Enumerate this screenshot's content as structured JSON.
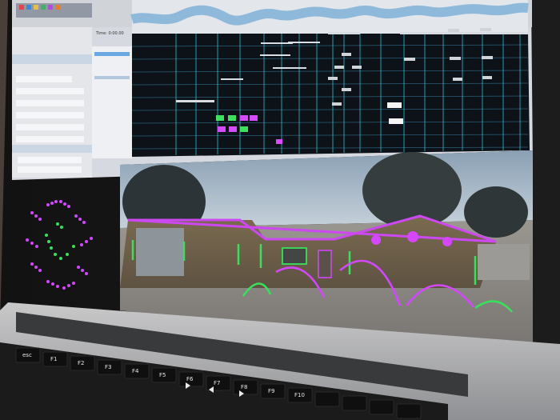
{
  "screen": {
    "sequencer": {
      "time_label": "Time: 0:00.00"
    },
    "preview": {
      "roof_outline_color": "#c93fe6",
      "light_green": "#38e15b",
      "light_magenta": "#d040ff"
    }
  },
  "keyboard_keys": [
    {
      "label": "esc"
    },
    {
      "label": "F1"
    },
    {
      "label": "F2"
    },
    {
      "label": "F3"
    },
    {
      "label": "F4"
    },
    {
      "label": "F5"
    },
    {
      "label": "F6"
    },
    {
      "label": "F7"
    },
    {
      "label": "F8"
    },
    {
      "label": "F9"
    },
    {
      "label": "F10"
    }
  ],
  "icons": {
    "play": "play-icon",
    "rewind": "rewind-icon",
    "fast_forward": "fast-forward-icon"
  }
}
